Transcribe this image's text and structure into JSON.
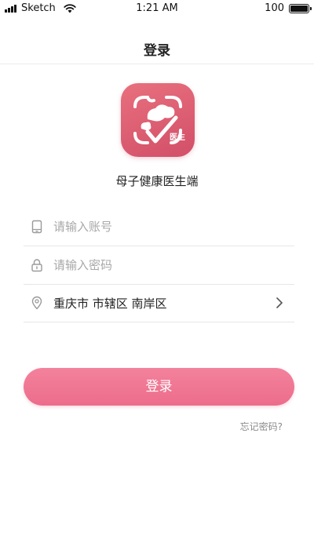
{
  "status_bar": {
    "carrier": "Sketch",
    "time": "1:21 AM",
    "battery_percent": "100",
    "battery_level": 1.0
  },
  "nav": {
    "title": "登录"
  },
  "app": {
    "logo_badge": "医生",
    "name": "母子健康医生端",
    "brand_color": "#e0607a"
  },
  "form": {
    "account": {
      "placeholder": "请输入账号",
      "value": "",
      "icon": "phone-icon"
    },
    "password": {
      "placeholder": "请输入密码",
      "value": "",
      "icon": "lock-icon"
    },
    "region": {
      "value": "重庆市 市辖区 南岸区",
      "icon": "location-pin-icon",
      "action_icon": "chevron-right-icon"
    }
  },
  "login_button": {
    "label": "登录",
    "color": "#ef7692"
  },
  "forgot_password": {
    "label": "忘记密码?"
  }
}
